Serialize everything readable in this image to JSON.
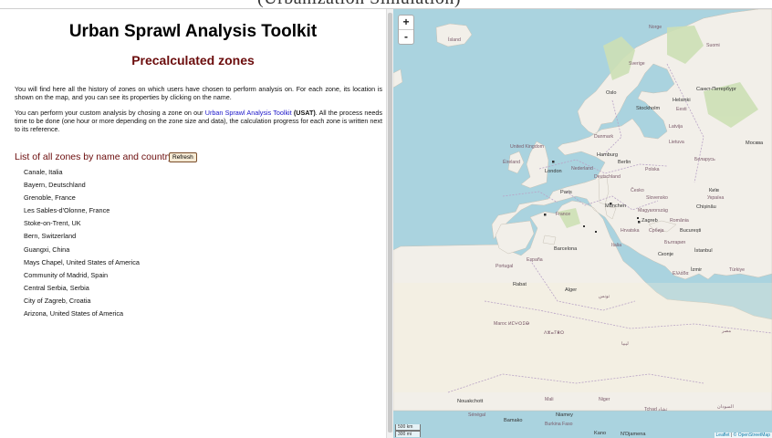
{
  "header": {
    "banner": "(Urbanization Simulation)"
  },
  "page": {
    "title": "Urban Sprawl Analysis Toolkit",
    "subtitle": "Precalculated zones",
    "intro": "You will find here all the history of zones on which users have chosen to perform analysis on. For each zone, its location is shown on the map, and you can see its properties by clicking on the name.",
    "custom_prefix": "You can perform your custom analysis by chosing a zone on our ",
    "usat_link": "Urban Sprawl Analysis Toolkit",
    "usat_abbrev": "(USAT)",
    "custom_suffix": ". All the process needs time to be done (one hour or more depending on the zone size and data), the calculation progress for each zone is written next to its reference."
  },
  "zone_list": {
    "heading": "List of all zones by name and country",
    "refresh_label": "Refresh",
    "items": [
      "Canale, Italia",
      "Bayern, Deutschland",
      "Grenoble, France",
      "Les Sables-d'Olonne, France",
      "Stoke-on-Trent, UK",
      "Bern, Switzerland",
      "Guangxi, China",
      "Mays Chapel, United States of America",
      "Community of Madrid, Spain",
      "Central Serbia, Serbia",
      "City of Zagreb, Croatia",
      "Arizona, United States of America"
    ]
  },
  "map": {
    "zoom_in": "+",
    "zoom_out": "-",
    "scale_km": "500 km",
    "scale_mi": "300 mi",
    "attribution_leaflet": "Leaflet",
    "attribution_osm": "© OpenStreetMap",
    "colors": {
      "sea": "#aad3df",
      "land": "#f2efe9",
      "border": "#b9a3c6"
    },
    "labels": {
      "island": "Ísland",
      "norge": "Norge",
      "suomi": "Suomi",
      "sverige": "Sverige",
      "oslo": "Oslo",
      "helsinki": "Helsinki",
      "spb": "Санкт-Петербург",
      "stockholm": "Stockholm",
      "eesti": "Eesti",
      "latvija": "Latvija",
      "danmark": "Danmark",
      "lietuva": "Lietuva",
      "moskva": "Москва",
      "uk": "United Kingdom",
      "ireland": "Éireland",
      "hamburg": "Hamburg",
      "berlin": "Berlin",
      "belarus": "Беларусь",
      "london": "London",
      "nederland": "Nederland",
      "deutschland": "Deutschland",
      "polska": "Polska",
      "paris": "Paris",
      "cesko": "Česko",
      "kyiv": "Київ",
      "ukraina": "Україна",
      "slovensko": "Slovensko",
      "munchen": "München",
      "magyarorszag": "Magyarország",
      "chisinau": "Chișinău",
      "france": "France",
      "zagreb": "Zagreb",
      "romania": "România",
      "hrvatska": "Hrvatska",
      "srbija": "Србија",
      "bucuresti": "București",
      "balgaria": "България",
      "italia": "Italia",
      "barcelona": "Barcelona",
      "skopje": "Скопје",
      "istanbul": "İstanbul",
      "portugal": "Portugal",
      "espana": "España",
      "ellada": "Ελλάδα",
      "izmir": "İzmir",
      "turkiye": "Türkiye",
      "rabat": "Rabat",
      "alger": "Alger",
      "tounes": "تونس",
      "maroc": "Maroc ⵍⵎⵖⵔⵉⴱ",
      "algerie": "ⴷⵣⴰⵢⴻⵔ",
      "libya": "ليبيا",
      "misr": "مصر",
      "nouakchott": "Nouakchott",
      "mali": "Mali",
      "niger": "Niger",
      "tchad": "Tchad تشاد",
      "sudan": "السودان",
      "senegal": "Sénégal",
      "bamako": "Bamako",
      "niamey": "Niamey",
      "burkina": "Burkina Faso",
      "kano": "Kano",
      "ndjamena": "N'Djamena"
    }
  }
}
